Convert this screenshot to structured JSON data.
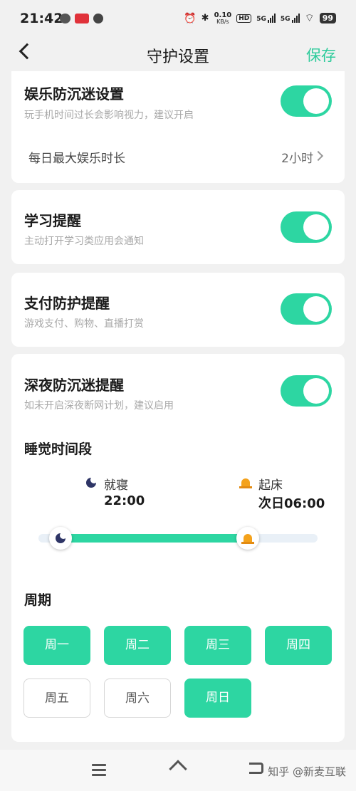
{
  "status_bar": {
    "time": "21:42",
    "net_speed": "0.10",
    "net_unit": "KB/s",
    "battery": "99",
    "sig1": "5G",
    "sig2": "5G"
  },
  "nav": {
    "title": "守护设置",
    "save_label": "保存"
  },
  "entertainment": {
    "title": "娱乐防沉迷设置",
    "subtitle": "玩手机时间过长会影响视力，建议开启",
    "enabled": true,
    "max_label": "每日最大娱乐时长",
    "max_value": "2小时"
  },
  "study": {
    "title": "学习提醒",
    "subtitle": "主动打开学习类应用会通知",
    "enabled": true
  },
  "payment": {
    "title": "支付防护提醒",
    "subtitle": "游戏支付、购物、直播打赏",
    "enabled": true
  },
  "night": {
    "title": "深夜防沉迷提醒",
    "subtitle": "如未开启深夜断网计划，建议启用",
    "enabled": true,
    "sleep_section": "睡觉时间段",
    "bedtime_label": "就寝",
    "bedtime_value": "22:00",
    "wake_label": "起床",
    "wake_value": "次日06:00",
    "range_start": 0.08,
    "range_end": 0.75,
    "period_section": "周期",
    "days": [
      {
        "label": "周一",
        "active": true
      },
      {
        "label": "周二",
        "active": true
      },
      {
        "label": "周三",
        "active": true
      },
      {
        "label": "周四",
        "active": true
      },
      {
        "label": "周五",
        "active": false
      },
      {
        "label": "周六",
        "active": false
      },
      {
        "label": "周日",
        "active": true
      }
    ]
  },
  "watermark": "知乎 @新麦互联",
  "colors": {
    "accent": "#2dd6a2",
    "save_text": "#2dcb9b"
  }
}
